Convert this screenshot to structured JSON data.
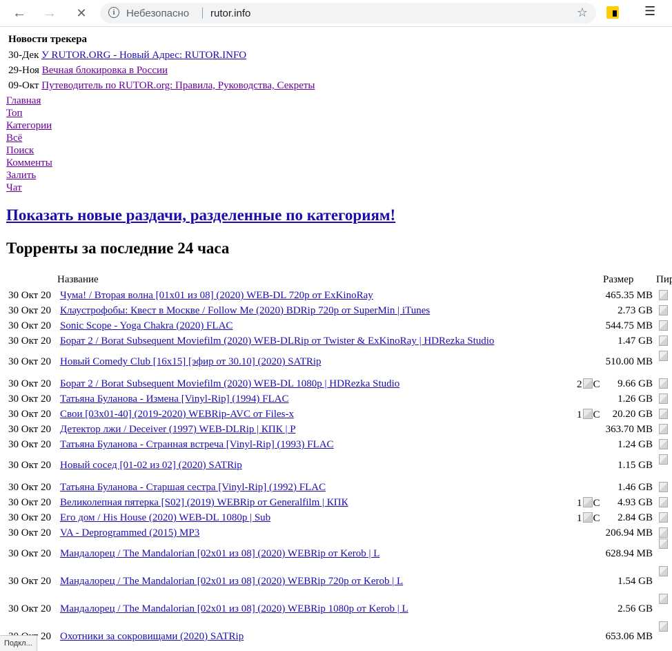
{
  "browser": {
    "status": "Небезопасно",
    "url": "rutor.info",
    "back_icon": "←",
    "forward_icon": "→",
    "reload_icon": "✕",
    "star_icon": "☆",
    "menu_icon": "☰"
  },
  "news": {
    "title": "Новости трекера",
    "items": [
      {
        "date": "30-Дек",
        "text": "У RUTOR.ORG - Новый Адрес: RUTOR.INFO"
      },
      {
        "date": "29-Ноя",
        "text": "Вечная блокировка в России"
      },
      {
        "date": "09-Окт",
        "text": "Путеводитель по RUTOR.org: Правила, Руководства, Секреты"
      }
    ]
  },
  "menu": [
    "Главная",
    "Топ",
    "Категории",
    "Всё",
    "Поиск",
    "Комменты",
    "Залить",
    "Чат"
  ],
  "categories_link": "Показать новые раздачи, разделенные по категориям!",
  "section_title": "Торренты за последние 24 часа",
  "table": {
    "col_name": "Название",
    "col_size": "Размер",
    "col_peers": "Пир",
    "rows": [
      {
        "date": "30 Окт 20",
        "name": "Чума! / Вторая волна [01x01 из 08] (2020) WEB-DL 720p от ExKinoRay",
        "comments": "",
        "size": "465.35 MB"
      },
      {
        "date": "30 Окт 20",
        "name": "Клаустрофобы: Квест в Москве / Follow Me (2020) BDRip 720p от SuperMin | iTunes",
        "comments": "",
        "size": "2.73 GB"
      },
      {
        "date": "30 Окт 20",
        "name": "Sonic Scope - Yoga Chakra (2020) FLAC",
        "comments": "",
        "size": "544.75 MB"
      },
      {
        "date": "30 Окт 20",
        "name": "Борат 2 / Borat Subsequent Moviefilm (2020) WEB-DLRip от Twister & ExKinoRay | HDRezka Studio",
        "comments": "",
        "size": "1.47 GB"
      },
      {
        "date": "30 Окт 20",
        "name": "Новый Comedy Club [16x15] [эфир от 30.10] (2020) SATRip",
        "comments": "",
        "size": "510.00 MB"
      },
      {
        "date": "30 Окт 20",
        "name": "Борат 2 / Borat Subsequent Moviefilm (2020) WEB-DL 1080p | HDRezka Studio",
        "comments": "2",
        "size": "9.66 GB"
      },
      {
        "date": "30 Окт 20",
        "name": "Татьяна Буланова - Измена [Vinyl-Rip] (1994) FLAC",
        "comments": "",
        "size": "1.26 GB"
      },
      {
        "date": "30 Окт 20",
        "name": "Свои [03x01-40] (2019-2020) WEBRip-AVC от Files-x",
        "comments": "1",
        "size": "20.20 GB"
      },
      {
        "date": "30 Окт 20",
        "name": "Детектор лжи / Deceiver (1997) WEB-DLRip | КПК | P",
        "comments": "",
        "size": "363.70 MB"
      },
      {
        "date": "30 Окт 20",
        "name": "Татьяна Буланова - Странная встреча [Vinyl-Rip] (1993) FLAC",
        "comments": "",
        "size": "1.24 GB"
      },
      {
        "date": "30 Окт 20",
        "name": "Новый сосед [01-02 из 02] (2020) SATRip",
        "comments": "",
        "size": "1.15 GB"
      },
      {
        "date": "30 Окт 20",
        "name": "Татьяна Буланова - Старшая сестра [Vinyl-Rip] (1992) FLAC",
        "comments": "",
        "size": "1.46 GB"
      },
      {
        "date": "30 Окт 20",
        "name": "Великолепная пятерка [S02] (2019) WEBRip от Generalfilm | КПК",
        "comments": "1",
        "size": "4.93 GB"
      },
      {
        "date": "30 Окт 20",
        "name": "Его дом / His House (2020) WEB-DL 1080p | Sub",
        "comments": "1",
        "size": "2.84 GB"
      },
      {
        "date": "30 Окт 20",
        "name": "VA - Deprogrammed (2015) MP3",
        "comments": "",
        "size": "206.94 MB"
      },
      {
        "date": "30 Окт 20",
        "name": "Мандалорец / The Mandalorian [02x01 из 08] (2020) WEBRip от Kerob | L",
        "comments": "",
        "size": "628.94 MB"
      },
      {
        "date": "30 Окт 20",
        "name": "Мандалорец / The Mandalorian [02x01 из 08] (2020) WEBRip 720p от Kerob | L",
        "comments": "",
        "size": "1.54 GB"
      },
      {
        "date": "30 Окт 20",
        "name": "Мандалорец / The Mandalorian [02x01 из 08] (2020) WEBRip 1080p от Kerob | L",
        "comments": "",
        "size": "2.56 GB"
      },
      {
        "date": "30 Окт 20",
        "name": "Охотники за сокровищами (2020) SATRip",
        "comments": "",
        "size": "653.06 MB"
      }
    ]
  },
  "statusbar": "Подкл..."
}
